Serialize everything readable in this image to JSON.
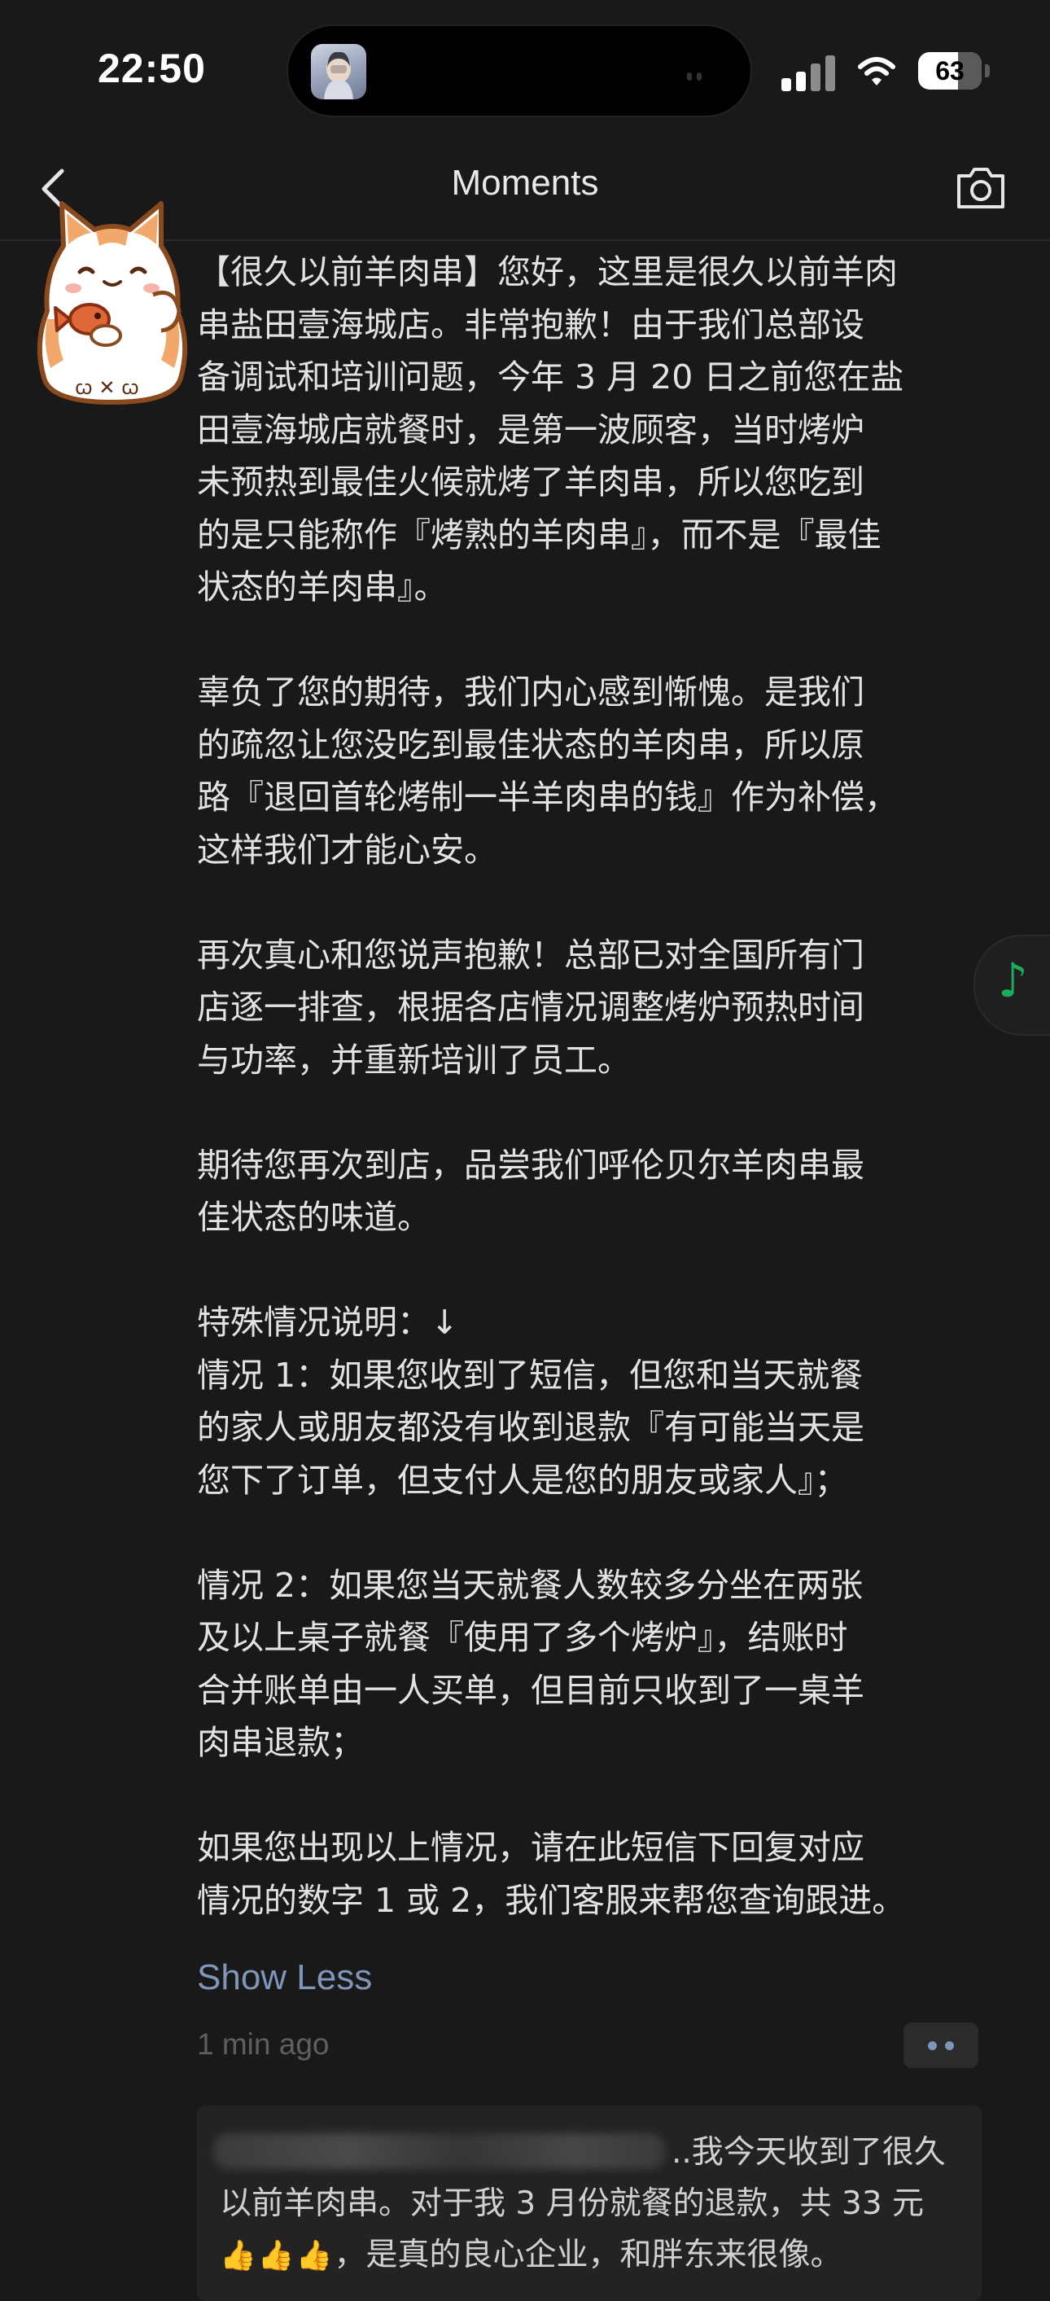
{
  "status_bar": {
    "time": "22:50",
    "battery": "63",
    "battery_level_percent": 63,
    "signal_icon": "signal-icon",
    "wifi_icon": "wifi-icon"
  },
  "nav": {
    "title": "Moments",
    "back_icon": "chevron-left-icon",
    "camera_icon": "camera-icon"
  },
  "post": {
    "paragraphs": [
      [
        "【很久以前羊肉串】您好，这里是很久以前羊肉",
        "串盐田壹海城店。非常抱歉！由于我们总部设",
        "备调试和培训问题，今年 3 月 20 日之前您在盐",
        "田壹海城店就餐时，是第一波顾客，当时烤炉",
        "未预热到最佳火候就烤了羊肉串，所以您吃到",
        "的是只能称作『烤熟的羊肉串』，而不是『最佳",
        "状态的羊肉串』。"
      ],
      [
        "辜负了您的期待，我们内心感到惭愧。是我们",
        "的疏忽让您没吃到最佳状态的羊肉串，所以原",
        "路『退回首轮烤制一半羊肉串的钱』作为补偿，",
        "这样我们才能心安。"
      ],
      [
        "再次真心和您说声抱歉！总部已对全国所有门",
        "店逐一排查，根据各店情况调整烤炉预热时间",
        "与功率，并重新培训了员工。"
      ],
      [
        "期待您再次到店，品尝我们呼伦贝尔羊肉串最",
        "佳状态的味道。"
      ],
      [
        "特殊情况说明：↓",
        "情况 1：如果您收到了短信，但您和当天就餐",
        "的家人或朋友都没有收到退款『有可能当天是",
        "您下了订单，但支付人是您的朋友或家人』；"
      ],
      [
        "情况 2：如果您当天就餐人数较多分坐在两张",
        "及以上桌子就餐『使用了多个烤炉』，结账时",
        "合并账单由一人买单，但目前只收到了一桌羊",
        "肉串退款；"
      ],
      [
        "如果您出现以上情况，请在此短信下回复对应",
        "情况的数字 1 或 2，我们客服来帮您查询跟进。"
      ]
    ],
    "show_less": "Show Less",
    "timestamp": "1 min ago",
    "more_icon": "more-dots-icon"
  },
  "comment": {
    "line1": "..我今天收到了很久",
    "line2": "以前羊肉串。对于我 3 月份就餐的退款，共 33 元",
    "thumbs": "👍👍👍",
    "line3": "，是真的良心企业，和胖东来很像。"
  },
  "floating": {
    "music_icon": "music-note-icon",
    "music_glyph": "♪"
  },
  "colors": {
    "background": "#191919",
    "text": "#e2e2e2",
    "link": "#7f95b9",
    "muted": "#5f5f5f",
    "music_green": "#1aad5b"
  }
}
